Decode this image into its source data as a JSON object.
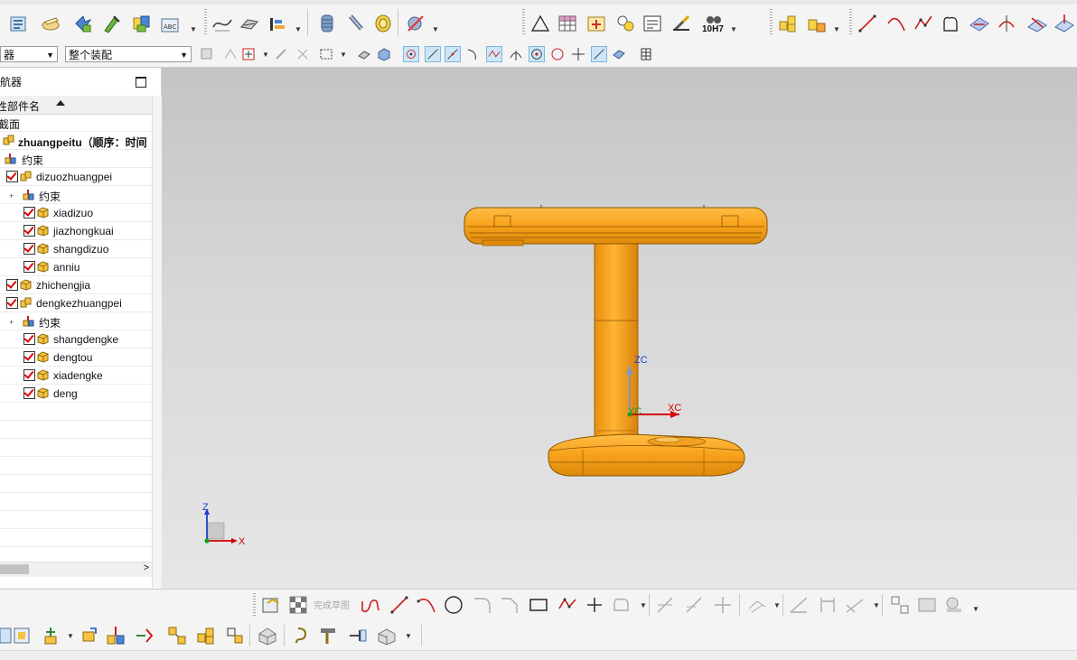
{
  "toolbar": {
    "filter_combo_value": "器",
    "assembly_combo_value": "整个装配",
    "tolerance_label": "10H7",
    "finish_sketch_label": "完成草图"
  },
  "navigator": {
    "title": "导航器",
    "column_header": "性部件名",
    "section_label": "截面",
    "root": "zhuangpeitu（顺序：时间",
    "root_constraints": "约束",
    "items": [
      {
        "label": "dizuozhuangpei"
      },
      {
        "label": "约束"
      },
      {
        "label": "xiadizuo"
      },
      {
        "label": "jiazhongkuai"
      },
      {
        "label": "shangdizuo"
      },
      {
        "label": "anniu"
      },
      {
        "label": "zhichengjia"
      },
      {
        "label": "dengkezhuangpei"
      },
      {
        "label": "约束"
      },
      {
        "label": "shangdengke"
      },
      {
        "label": "dengtou"
      },
      {
        "label": "xiadengke"
      },
      {
        "label": "deng"
      }
    ],
    "scroll_right_glyph": ">"
  },
  "viewport": {
    "wcs_x_label": "XC",
    "wcs_z_label": "ZC",
    "wcs_y_label": "YC",
    "triad_x_label": "X",
    "triad_z_label": "Z"
  },
  "colors": {
    "model_orange": "#f7a21b",
    "model_shade": "#d9820a",
    "x_axis": "#d40000",
    "z_axis": "#2040d0",
    "y_axis": "#18a018",
    "checkbox_tick": "#dd0000"
  }
}
